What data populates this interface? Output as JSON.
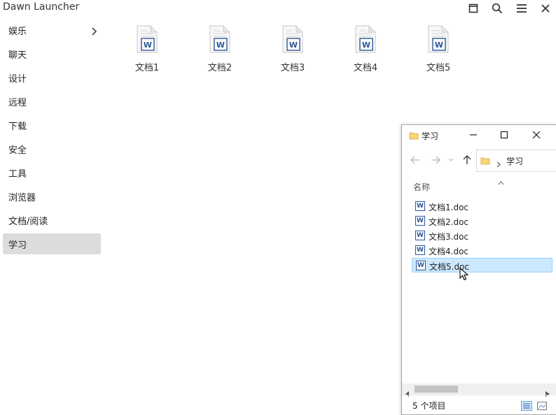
{
  "app": {
    "title": "Dawn Launcher"
  },
  "sidebar": {
    "items": [
      {
        "label": "娱乐",
        "has_submenu": true
      },
      {
        "label": "聊天"
      },
      {
        "label": "设计"
      },
      {
        "label": "远程"
      },
      {
        "label": "下载"
      },
      {
        "label": "安全"
      },
      {
        "label": "工具"
      },
      {
        "label": "浏览器"
      },
      {
        "label": "文档/阅读"
      },
      {
        "label": "学习",
        "active": true
      }
    ]
  },
  "files": [
    {
      "label": "文档1"
    },
    {
      "label": "文档2"
    },
    {
      "label": "文档3"
    },
    {
      "label": "文档4"
    },
    {
      "label": "文档5"
    }
  ],
  "explorer": {
    "title": "学习",
    "address_crumb": "学习",
    "column_header": "名称",
    "rows": [
      {
        "name": "文档1.doc"
      },
      {
        "name": "文档2.doc"
      },
      {
        "name": "文档3.doc"
      },
      {
        "name": "文档4.doc"
      },
      {
        "name": "文档5.doc",
        "selected": true
      }
    ],
    "status": "5 个项目"
  },
  "icons": {
    "word_letter": "W"
  },
  "colors": {
    "word_blue": "#2b5797",
    "selection_bg": "#cce8ff",
    "folder_yellow": "#f8d775"
  }
}
